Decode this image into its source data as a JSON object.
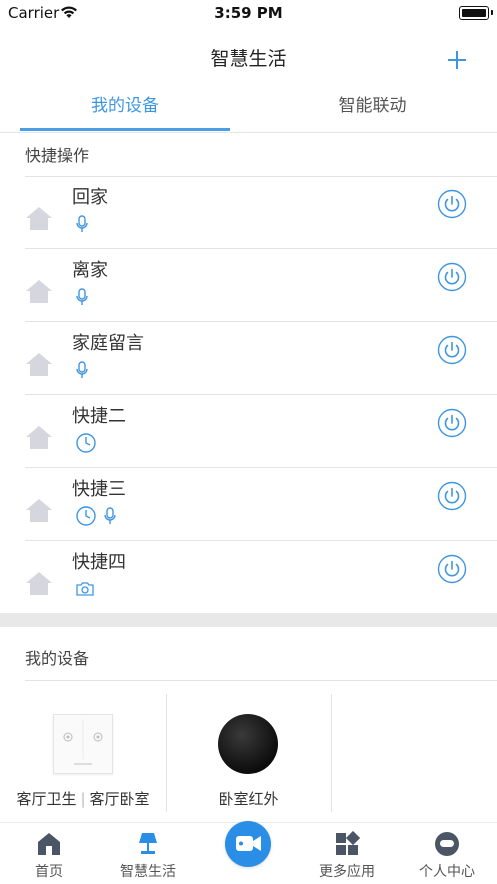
{
  "status_bar": {
    "carrier": "Carrier",
    "time": "3:59 PM"
  },
  "nav": {
    "title": "智慧生活"
  },
  "tabs": [
    {
      "label": "我的设备"
    },
    {
      "label": "智能联动"
    }
  ],
  "quick_section": {
    "title": "快捷操作",
    "items": [
      {
        "label": "回家",
        "tags": [
          "mic-icon"
        ]
      },
      {
        "label": "离家",
        "tags": [
          "mic-icon"
        ]
      },
      {
        "label": "家庭留言",
        "tags": [
          "mic-icon"
        ]
      },
      {
        "label": "快捷二",
        "tags": [
          "clock-icon"
        ]
      },
      {
        "label": "快捷三",
        "tags": [
          "clock-icon",
          "mic-icon"
        ]
      },
      {
        "label": "快捷四",
        "tags": [
          "camera-icon"
        ]
      }
    ]
  },
  "devices_section": {
    "title": "我的设备",
    "devices": [
      {
        "name_part1": "客厅卫生",
        "name_part2": "客厅卧室",
        "separator": "|",
        "icon": "wall-switch-image"
      },
      {
        "name": "卧室红外",
        "icon": "ir-remote-image"
      }
    ]
  },
  "tab_bar": {
    "items": [
      {
        "label": "首页",
        "icon": "home-icon"
      },
      {
        "label": "智慧生活",
        "icon": "lamp-icon"
      },
      {
        "label": "",
        "icon": "video-camera-icon"
      },
      {
        "label": "更多应用",
        "icon": "apps-grid-icon"
      },
      {
        "label": "个人中心",
        "icon": "profile-icon"
      }
    ]
  },
  "colors": {
    "accent": "#3e96e3",
    "home_icon": "#d6d6df",
    "divider": "#e3e3e3",
    "band": "#e8e8e8",
    "camera_button": "#2a8de6",
    "tab_icon": "#4a5566"
  }
}
